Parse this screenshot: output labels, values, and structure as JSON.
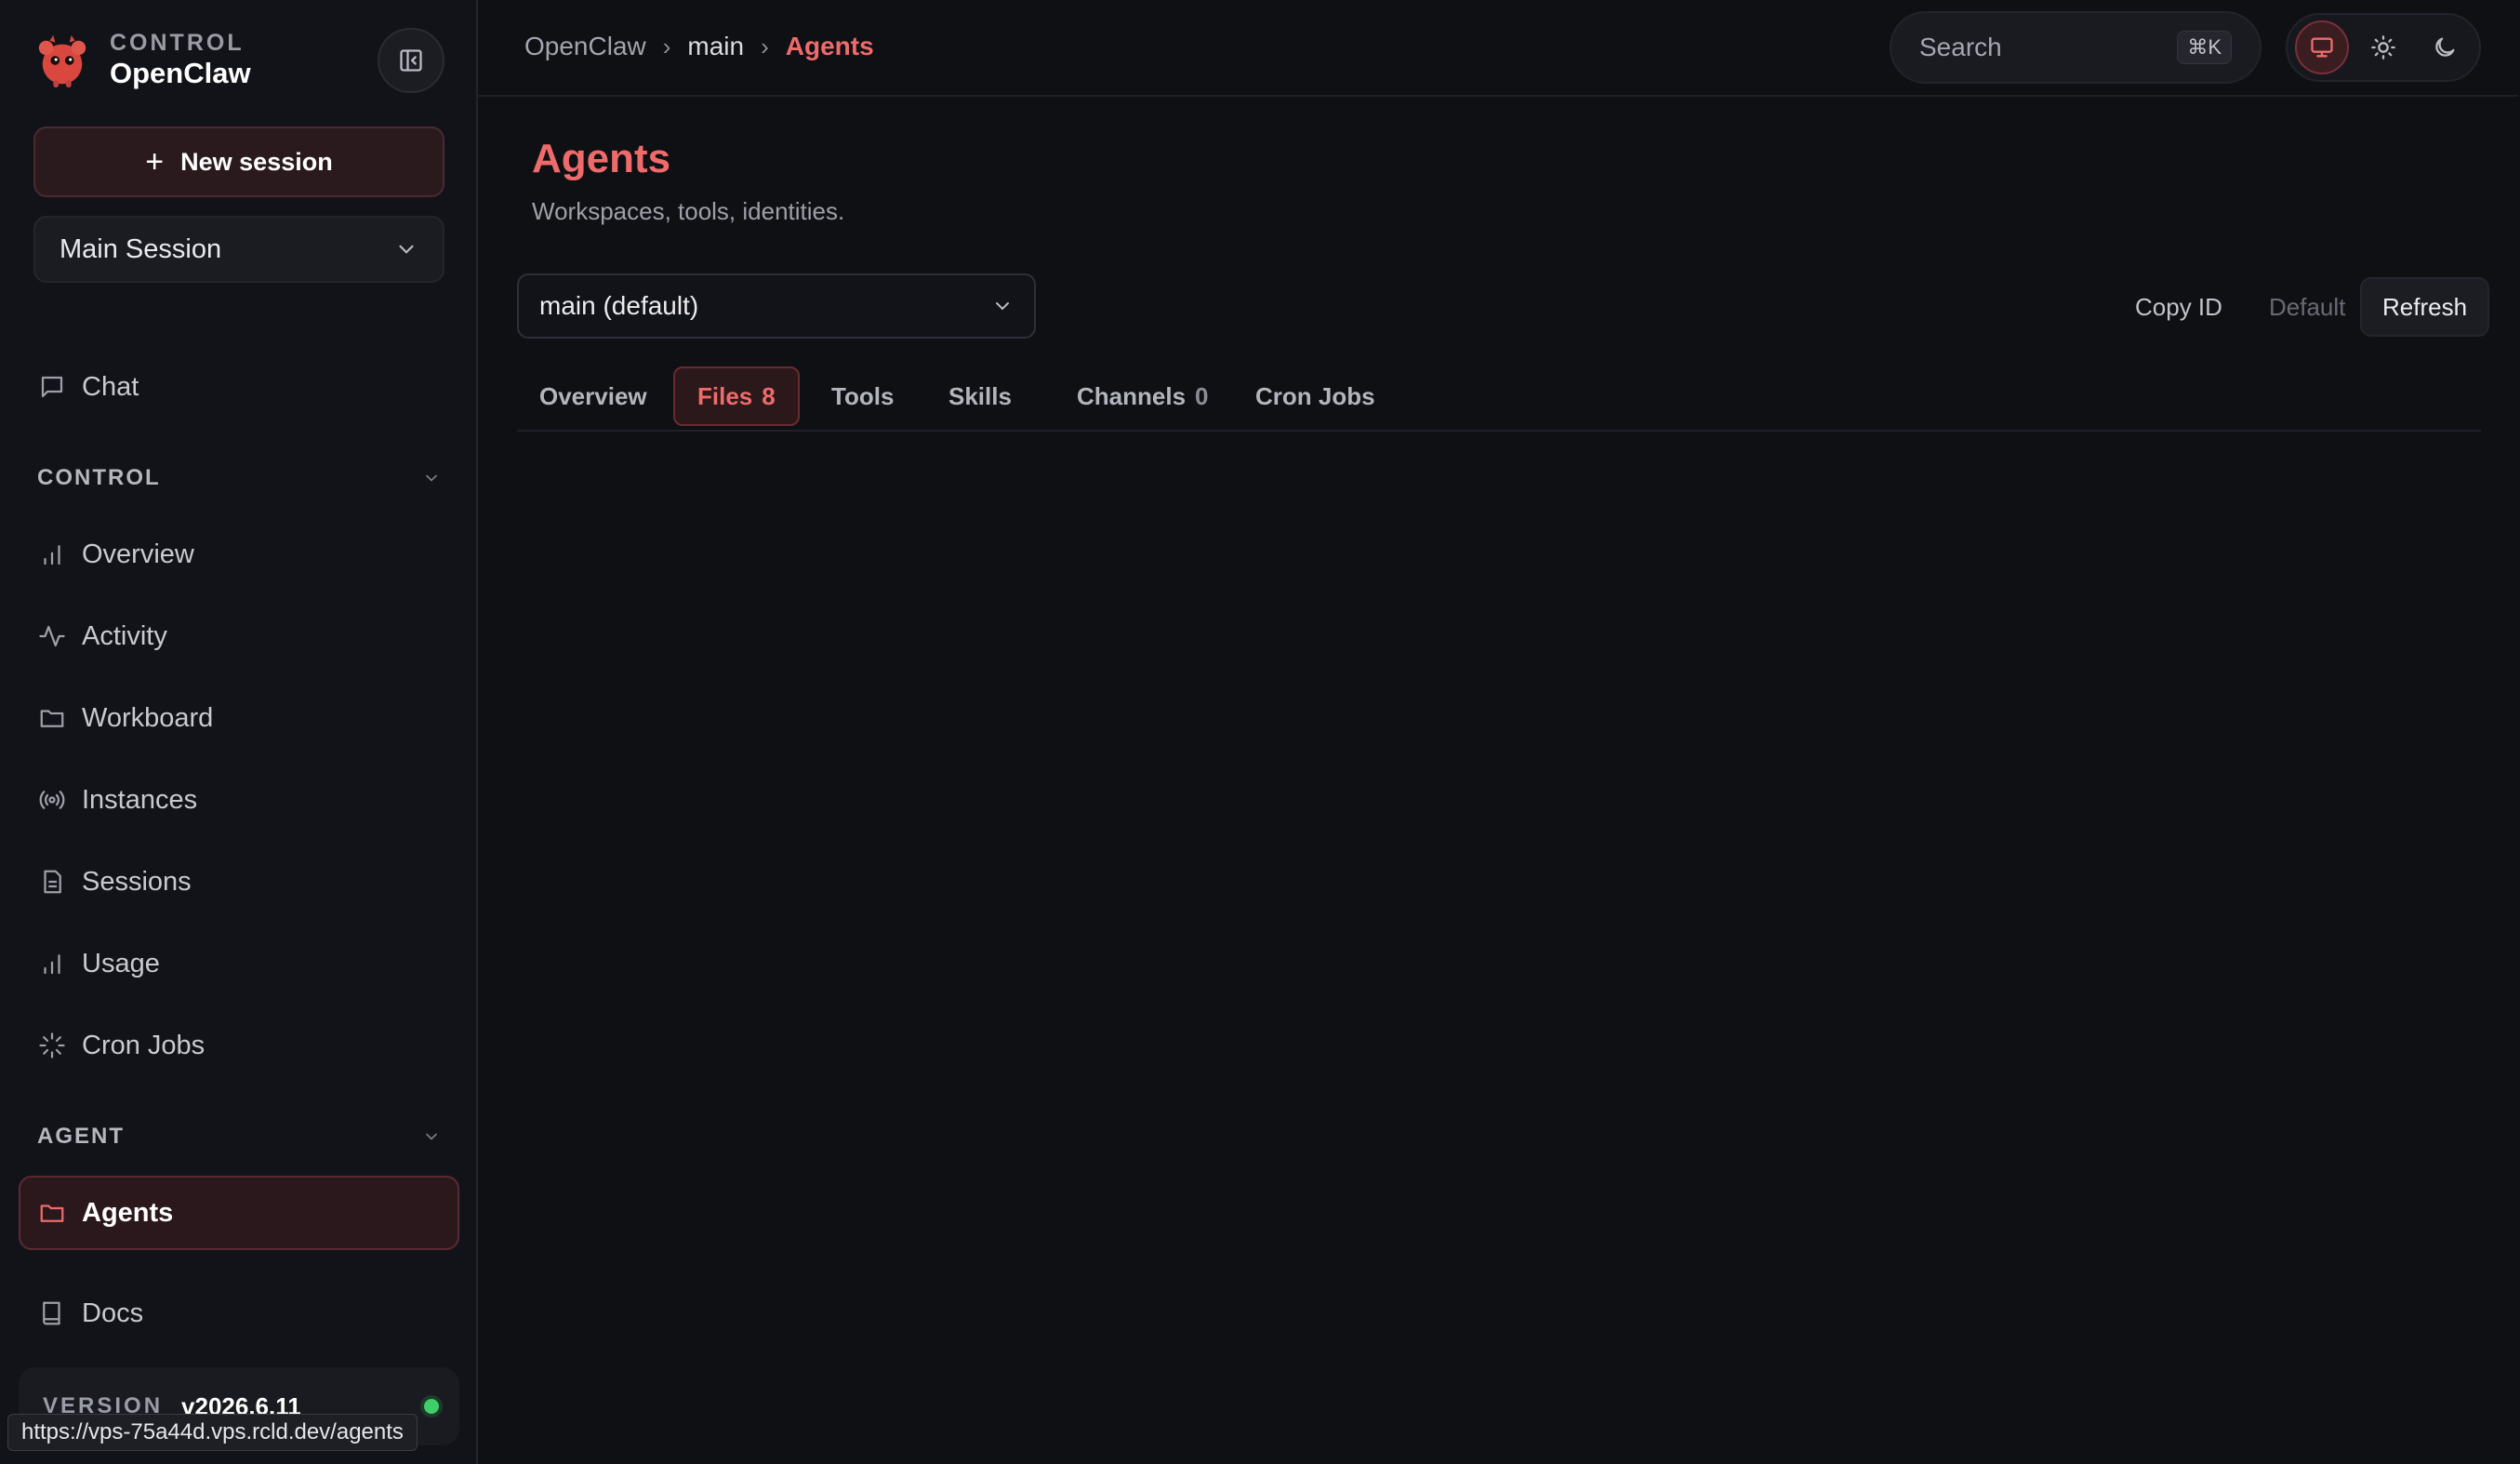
{
  "brand": {
    "kicker": "CONTROL",
    "name": "OpenClaw",
    "logo_icon": "red-claw-mascot",
    "accent": "#ef6b6b"
  },
  "sidebar": {
    "new_session_label": "New session",
    "session_select_value": "Main Session",
    "chat_label": "Chat",
    "control_section": "CONTROL",
    "control_items": [
      {
        "label": "Overview",
        "icon": "bar-chart-icon"
      },
      {
        "label": "Activity",
        "icon": "activity-icon"
      },
      {
        "label": "Workboard",
        "icon": "folder-icon"
      },
      {
        "label": "Instances",
        "icon": "broadcast-icon"
      },
      {
        "label": "Sessions",
        "icon": "file-text-icon"
      },
      {
        "label": "Usage",
        "icon": "bar-chart-icon"
      },
      {
        "label": "Cron Jobs",
        "icon": "loader-icon"
      }
    ],
    "agent_section": "AGENT",
    "agent_items": [
      {
        "label": "Agents",
        "icon": "folder-icon",
        "active": true
      }
    ],
    "docs_label": "Docs",
    "version_label": "VERSION",
    "version_value": "v2026.6.11",
    "status_color": "#3ecf6a",
    "url_tooltip": "https://vps-75a44d.vps.rcld.dev/agents"
  },
  "topbar": {
    "breadcrumbs": [
      "OpenClaw",
      "main",
      "Agents"
    ],
    "search_placeholder": "Search",
    "search_shortcut": "⌘K"
  },
  "page": {
    "title": "Agents",
    "subtitle": "Workspaces, tools, identities.",
    "agent_select_value": "main (default)",
    "actions": {
      "copy_id": "Copy ID",
      "default": "Default",
      "refresh": "Refresh"
    },
    "tabs": [
      {
        "label": "Overview",
        "count": ""
      },
      {
        "label": "Files",
        "count": "8",
        "active": true
      },
      {
        "label": "Tools",
        "count": ""
      },
      {
        "label": "Skills",
        "count": ""
      },
      {
        "label": "Channels",
        "count": "0"
      },
      {
        "label": "Cron Jobs",
        "count": ""
      }
    ]
  }
}
